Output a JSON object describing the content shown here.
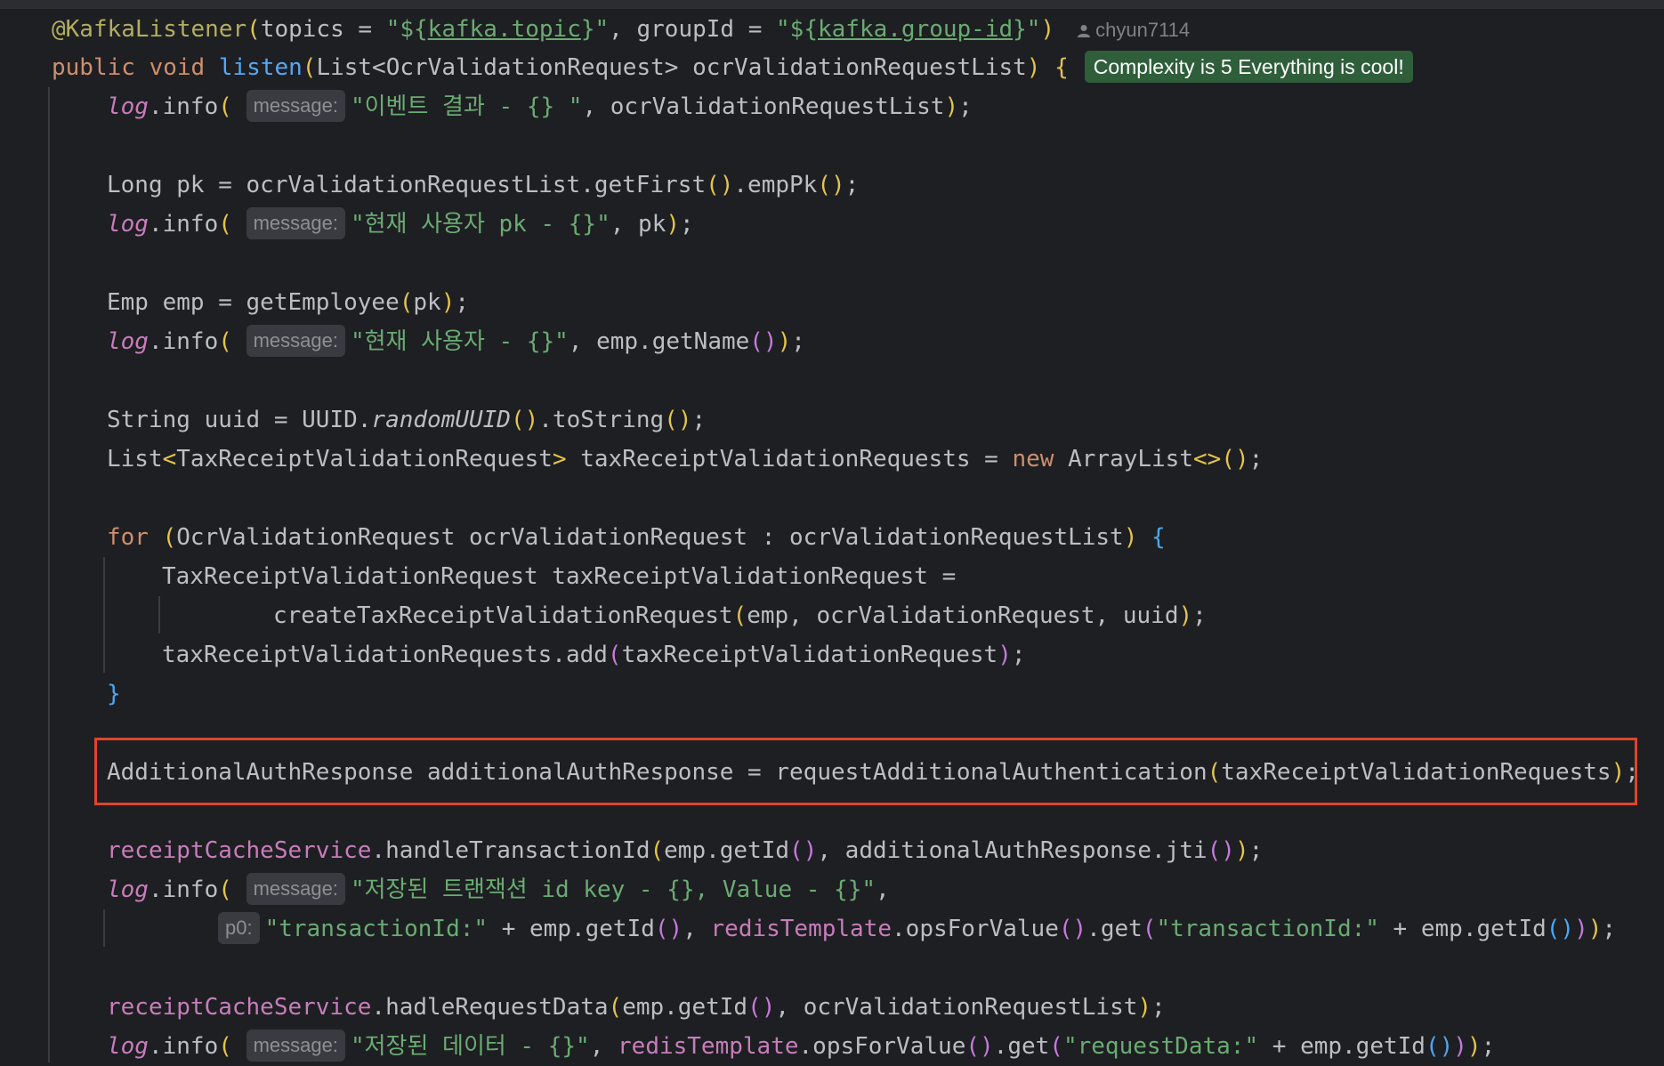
{
  "annotation": {
    "name": "@KafkaListener",
    "topics_key": "topics",
    "topics_open": "\"${",
    "topics_prop": "kafka.topic",
    "topics_close": "}\"",
    "group_key": "groupId",
    "group_open": "\"${",
    "group_prop": "kafka.group-id",
    "group_close": "}\""
  },
  "author_hint": "chyun7114",
  "complexity_badge": "Complexity is 5 Everything is cool!",
  "method": {
    "modifiers_public": "public",
    "modifiers_void": "void",
    "name": "listen",
    "param_type": "List<OcrValidationRequest>",
    "param_name": "ocrValidationRequestList"
  },
  "hint_labels": {
    "message": "message:",
    "p0": "p0:"
  },
  "strings": {
    "event_result": "\"이벤트 결과 - {} \"",
    "current_user_pk": "\"현재 사용자 pk - {}\"",
    "current_user": "\"현재 사용자 - {}\"",
    "saved_tx": "\"저장된 트랜잭션 id key - {}, Value - {}\"",
    "tx_id_1": "\"transactionId:\"",
    "tx_id_2": "\"transactionId:\"",
    "saved_data": "\"저장된 데이터 - {}\"",
    "request_data": "\"requestData:\""
  },
  "code": {
    "l3_tail": ", ocrValidationRequestList",
    "l5": "Long pk = ocrValidationRequestList.getFirst",
    "l5_tail": ".empPk",
    "l6_tail": ", pk",
    "l8": "Emp emp = getEmployee",
    "l8_arg": "pk",
    "l9_tail": ", emp.getName",
    "l11_a": "String uuid = UUID.",
    "l11_b": "randomUUID",
    "l11_c": ".toString",
    "l12_a": "List",
    "l12_b": "TaxReceiptValidationRequest",
    "l12_c": " taxReceiptValidationRequests = ",
    "l12_new": "new",
    "l12_d": " ArrayList",
    "l14_for": "for",
    "l14_body": "OcrValidationRequest ocrValidationRequest : ocrValidationRequestList",
    "l15": "TaxReceiptValidationRequest taxReceiptValidationRequest =",
    "l16_fn": "createTaxReceiptValidationRequest",
    "l16_args": "emp, ocrValidationRequest, uuid",
    "l17_a": "taxReceiptValidationRequests.add",
    "l17_b": "taxReceiptValidationRequest",
    "l20_a": "AdditionalAuthResponse additionalAuthResponse = requestAdditionalAuthentication",
    "l20_b": "taxReceiptValidationRequests",
    "l22_field": "receiptCacheService",
    "l22_a": ".handleTransactionId",
    "l22_b": "emp.getId",
    "l22_c": ", additionalAuthResponse.jti",
    "l24_a": " + emp.getId",
    "l24_field": "redisTemplate",
    "l24_b": ".opsForValue",
    "l24_c": ".get",
    "l24_d": " + emp.getId",
    "l26_field": "receiptCacheService",
    "l26_a": ".hadleRequestData",
    "l26_b": "emp.getId",
    "l26_c": ", ocrValidationRequestList",
    "l27_field": "redisTemplate",
    "l27_a": ".opsForValue",
    "l27_b": ".get",
    "l27_c": " + emp.getId",
    "log": "log",
    "info": ".info"
  },
  "colors": {
    "background": "#1e1f22",
    "keyword": "#cf8e6d",
    "string": "#6aab73",
    "function": "#56a8f5",
    "field": "#c77dbb",
    "annotation": "#b3ae60",
    "badge": "#2f5e3b",
    "highlight_border": "#e0442e"
  }
}
